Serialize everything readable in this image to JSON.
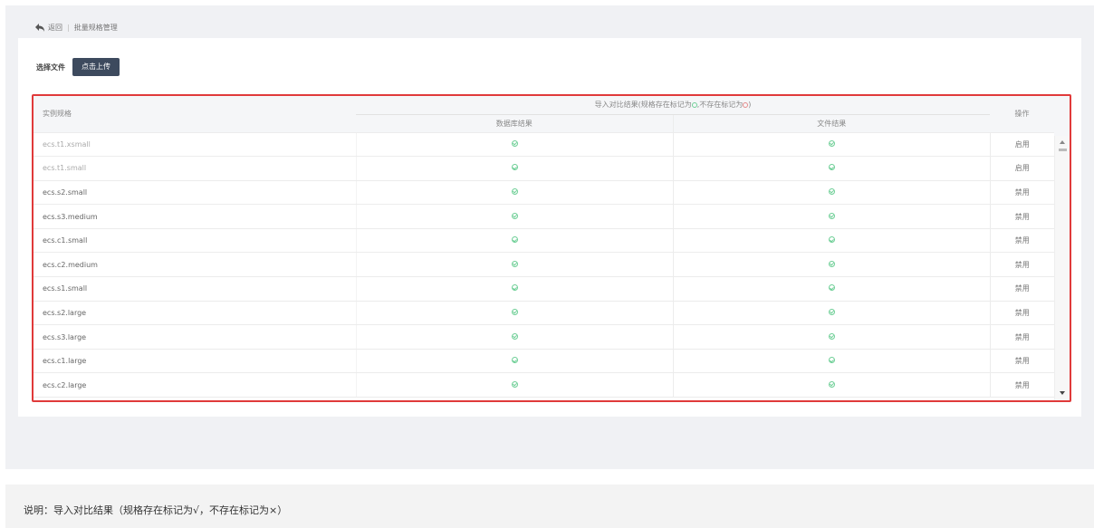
{
  "breadcrumb": {
    "back": "返回",
    "current": "批量规格管理"
  },
  "upload": {
    "label": "选择文件",
    "button": "点击上传"
  },
  "table": {
    "col_spec": "实例规格",
    "group_header": "导入对比结果(规格存在标记为",
    "group_header_mid": ",不存在标记为",
    "group_header_end": ")",
    "col_db": "数据库结果",
    "col_file": "文件结果",
    "col_action": "操作",
    "rows": [
      {
        "spec": "ecs.t1.xsmall",
        "action": "启用",
        "disabled": true
      },
      {
        "spec": "ecs.t1.small",
        "action": "启用",
        "disabled": true
      },
      {
        "spec": "ecs.s2.small",
        "action": "禁用",
        "disabled": false
      },
      {
        "spec": "ecs.s3.medium",
        "action": "禁用",
        "disabled": false
      },
      {
        "spec": "ecs.c1.small",
        "action": "禁用",
        "disabled": false
      },
      {
        "spec": "ecs.c2.medium",
        "action": "禁用",
        "disabled": false
      },
      {
        "spec": "ecs.s1.small",
        "action": "禁用",
        "disabled": false
      },
      {
        "spec": "ecs.s2.large",
        "action": "禁用",
        "disabled": false
      },
      {
        "spec": "ecs.s3.large",
        "action": "禁用",
        "disabled": false
      },
      {
        "spec": "ecs.c1.large",
        "action": "禁用",
        "disabled": false
      },
      {
        "spec": "ecs.c2.large",
        "action": "禁用",
        "disabled": false
      }
    ]
  },
  "note": "说明：导入对比结果（规格存在标记为√，不存在标记为×）",
  "colors": {
    "highlight_border": "#e03a3a",
    "upload_button": "#3d4a5e",
    "ok_mark": "#6fcf97"
  }
}
